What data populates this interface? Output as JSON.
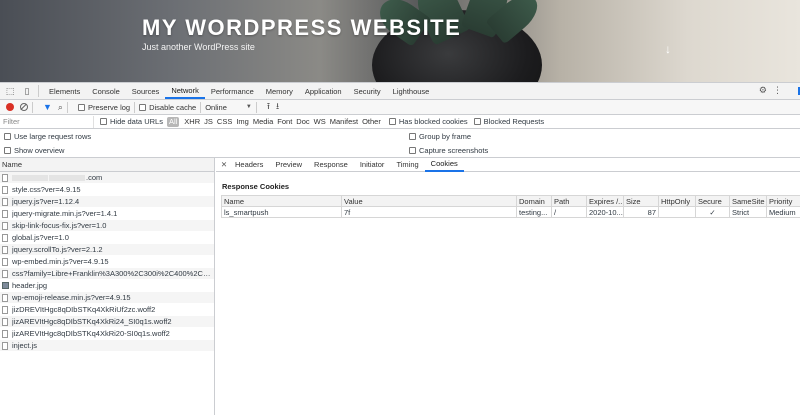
{
  "banner": {
    "site_title": "MY WORDPRESS WEBSITE",
    "tagline": "Just another WordPress site",
    "scroll_icon": "down-arrow-icon"
  },
  "devtools": {
    "tabs": [
      "Elements",
      "Console",
      "Sources",
      "Network",
      "Performance",
      "Memory",
      "Application",
      "Security",
      "Lighthouse"
    ],
    "active_tab": "Network",
    "toolbar": {
      "preserve_log": "Preserve log",
      "disable_cache": "Disable cache",
      "throttling": "Online"
    },
    "filter": {
      "placeholder": "Filter",
      "hide_data_urls": "Hide data URLs",
      "types": [
        "All",
        "XHR",
        "JS",
        "CSS",
        "Img",
        "Media",
        "Font",
        "Doc",
        "WS",
        "Manifest",
        "Other"
      ],
      "has_blocked_cookies": "Has blocked cookies",
      "blocked_requests": "Blocked Requests"
    },
    "options": {
      "large_rows": "Use large request rows",
      "group_by_frame": "Group by frame",
      "show_overview": "Show overview",
      "capture_screenshots": "Capture screenshots"
    },
    "requests_header": "Name",
    "requests": [
      ".com",
      "style.css?ver=4.9.15",
      "jquery.js?ver=1.12.4",
      "jquery-migrate.min.js?ver=1.4.1",
      "skip-link-focus-fix.js?ver=1.0",
      "global.js?ver=1.0",
      "jquery.scrollTo.js?ver=2.1.2",
      "wp-embed.min.js?ver=4.9.15",
      "css?family=Libre+Franklin%3A300%2C300i%2C400%2C400...C6...",
      "header.jpg",
      "wp-emoji-release.min.js?ver=4.9.15",
      "jizDREVItHgc8qDIbSTKq4XkRiUf2zc.woff2",
      "jizAREVItHgc8qDIbSTKq4XkRi24_SI0q1s.woff2",
      "jizAREVItHgc8qDIbSTKq4XkRi20-SI0q1s.woff2",
      "inject.js"
    ],
    "detail_tabs": [
      "Headers",
      "Preview",
      "Response",
      "Initiator",
      "Timing",
      "Cookies"
    ],
    "active_detail_tab": "Cookies",
    "response_cookies": {
      "title": "Response Cookies",
      "columns": [
        "Name",
        "Value",
        "Domain",
        "Path",
        "Expires /...",
        "Size",
        "HttpOnly",
        "Secure",
        "SameSite",
        "Priority"
      ],
      "rows": [
        [
          "ls_smartpush",
          "7f",
          "testing...",
          "/",
          "2020-10...",
          "87",
          "",
          "✓",
          "Strict",
          "Medium"
        ]
      ]
    }
  }
}
